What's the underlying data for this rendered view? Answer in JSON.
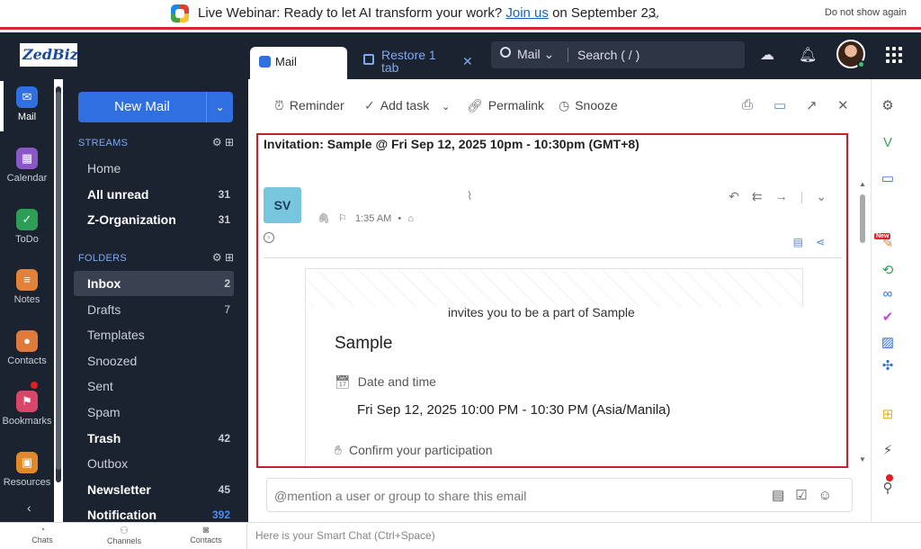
{
  "banner": {
    "prefix": "Live Webinar: Ready to let AI transform your work?",
    "link": "Join us",
    "suffix": "on September 23.",
    "dismiss": "Do not show again"
  },
  "brand": {
    "logo": "ZedBiz"
  },
  "rail": [
    {
      "label": "Mail",
      "icon": "mail-icon",
      "color": "#2f6fe0"
    },
    {
      "label": "Calendar",
      "icon": "calendar-icon",
      "color": "#8a57c9"
    },
    {
      "label": "ToDo",
      "icon": "todo-icon",
      "color": "#2e9e57"
    },
    {
      "label": "Notes",
      "icon": "notes-icon",
      "color": "#e1823a"
    },
    {
      "label": "Contacts",
      "icon": "contacts-icon",
      "color": "#e07a3a"
    },
    {
      "label": "Bookmarks",
      "icon": "bookmark-icon",
      "color": "#d9466a"
    },
    {
      "label": "Resources",
      "icon": "resources-icon",
      "color": "#e0892a"
    }
  ],
  "panel": {
    "new_mail": "New Mail",
    "streams_title": "STREAMS",
    "streams": [
      {
        "name": "Home",
        "count": ""
      },
      {
        "name": "All unread",
        "count": "31"
      },
      {
        "name": "Z-Organization",
        "count": "31"
      }
    ],
    "folders_title": "FOLDERS",
    "folders": [
      {
        "name": "Inbox",
        "count": "2"
      },
      {
        "name": "Drafts",
        "count": "7"
      },
      {
        "name": "Templates",
        "count": ""
      },
      {
        "name": "Snoozed",
        "count": ""
      },
      {
        "name": "Sent",
        "count": ""
      },
      {
        "name": "Spam",
        "count": ""
      },
      {
        "name": "Trash",
        "count": "42"
      },
      {
        "name": "Outbox",
        "count": ""
      },
      {
        "name": "Newsletter",
        "count": "45"
      },
      {
        "name": "Notification",
        "count": "392"
      }
    ]
  },
  "statusbar": {
    "chats": "Chats",
    "channels": "Channels",
    "contacts": "Contacts",
    "smart_chat": "Here is your Smart Chat (Ctrl+Space)"
  },
  "tabs": {
    "mail": "Mail",
    "restore": "Restore 1 tab"
  },
  "search": {
    "scope": "Mail",
    "placeholder": "Search ( / )"
  },
  "toolbar": {
    "reminder": "Reminder",
    "add_task": "Add task",
    "permalink": "Permalink",
    "snooze": "Snooze"
  },
  "email": {
    "subject": "Invitation: Sample @ Fri Sep 12, 2025 10pm - 10:30pm (GMT+8)",
    "sender_initials": "SV",
    "time": "1:35 AM",
    "card": {
      "invite_text": "invites you to be a part of Sample",
      "title": "Sample",
      "date_label": "Date and time",
      "date_value": "Fri Sep 12, 2025 10:00 PM - 10:30 PM (Asia/Manila)",
      "confirm_label": "Confirm your participation"
    }
  },
  "mention": {
    "placeholder": "@mention a user or group to share this email"
  },
  "colors": {
    "accent": "#2f6fe0",
    "highlight_border": "#c8202a",
    "sidebar_bg": "#1c2330"
  }
}
